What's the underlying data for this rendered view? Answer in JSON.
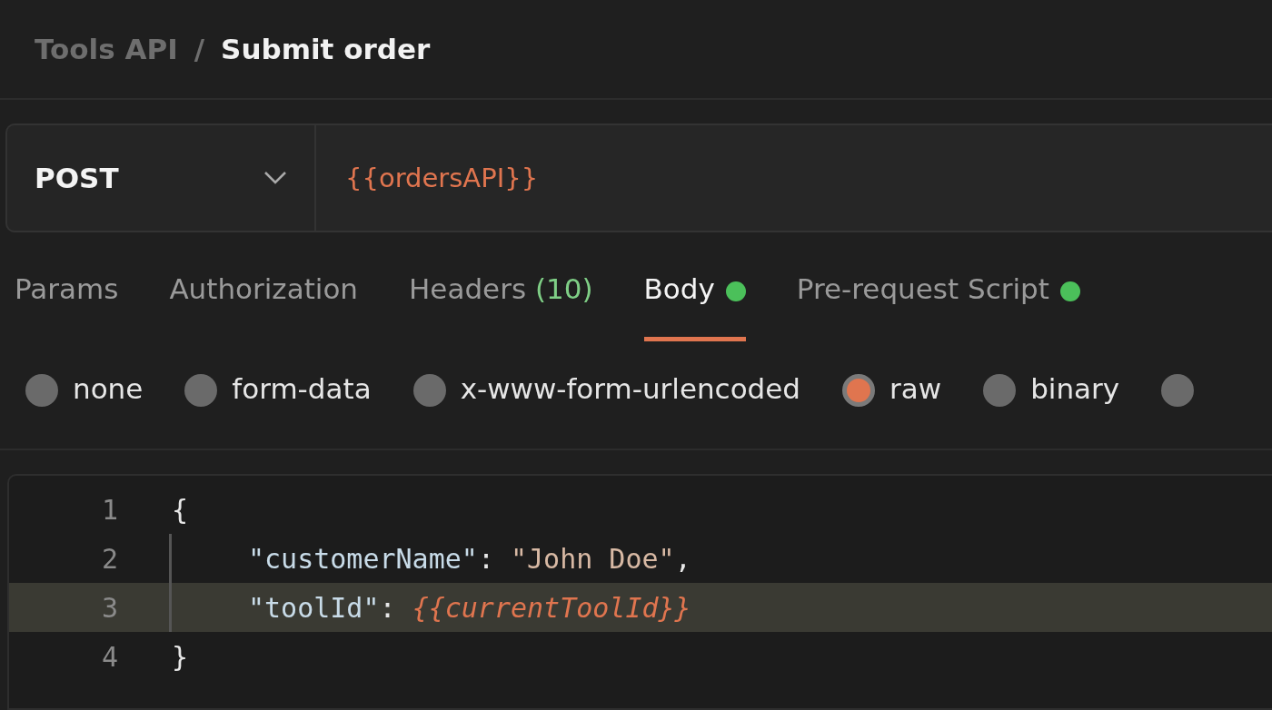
{
  "breadcrumb": {
    "collection": "Tools API",
    "separator": "/",
    "request": "Submit order"
  },
  "request": {
    "method": "POST",
    "url": "{{ordersAPI}}"
  },
  "tabs": [
    {
      "label": "Params",
      "selected": false,
      "dot": false
    },
    {
      "label": "Authorization",
      "selected": false,
      "dot": false
    },
    {
      "label": "Headers",
      "count": "(10)",
      "selected": false,
      "dot": false
    },
    {
      "label": "Body",
      "selected": true,
      "dot": true
    },
    {
      "label": "Pre-request Script",
      "selected": false,
      "dot": true
    }
  ],
  "body_types": [
    {
      "label": "none",
      "selected": false
    },
    {
      "label": "form-data",
      "selected": false
    },
    {
      "label": "x-www-form-urlencoded",
      "selected": false
    },
    {
      "label": "raw",
      "selected": true
    },
    {
      "label": "binary",
      "selected": false
    },
    {
      "selected": false
    }
  ],
  "editor": {
    "lines": [
      {
        "number": "1",
        "indent": false,
        "highlighted": false,
        "tokens": [
          {
            "kind": "punct",
            "text": "{"
          }
        ]
      },
      {
        "number": "2",
        "indent": true,
        "highlighted": false,
        "tokens": [
          {
            "kind": "key",
            "text": "\"customerName\""
          },
          {
            "kind": "punct",
            "text": ": "
          },
          {
            "kind": "string",
            "text": "\"John Doe\""
          },
          {
            "kind": "punct",
            "text": ","
          }
        ]
      },
      {
        "number": "3",
        "indent": true,
        "highlighted": true,
        "tokens": [
          {
            "kind": "key",
            "text": "\"toolId\""
          },
          {
            "kind": "punct",
            "text": ": "
          },
          {
            "kind": "variable",
            "text": "{{currentToolId}}"
          }
        ]
      },
      {
        "number": "4",
        "indent": false,
        "highlighted": false,
        "tokens": [
          {
            "kind": "punct",
            "text": "}"
          }
        ]
      }
    ]
  }
}
